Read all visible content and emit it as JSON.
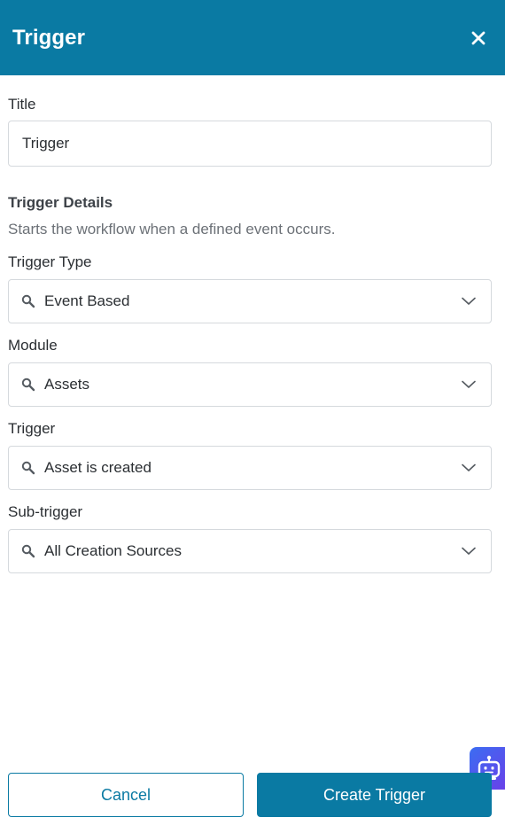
{
  "header": {
    "title": "Trigger",
    "close_icon": "close-icon"
  },
  "title_field": {
    "label": "Title",
    "value": "Trigger"
  },
  "details": {
    "heading": "Trigger Details",
    "description": "Starts the workflow when a defined event occurs."
  },
  "trigger_type": {
    "label": "Trigger Type",
    "value": "Event Based"
  },
  "module": {
    "label": "Module",
    "value": "Assets"
  },
  "trigger": {
    "label": "Trigger",
    "value": "Asset is created"
  },
  "sub_trigger": {
    "label": "Sub-trigger",
    "value": "All Creation Sources"
  },
  "footer": {
    "cancel_label": "Cancel",
    "create_label": "Create Trigger"
  },
  "colors": {
    "primary": "#0a7aa3",
    "border": "#d5d9dd",
    "bot_gradient_start": "#3b6df2",
    "bot_gradient_end": "#6b3fe8"
  },
  "icons": {
    "select_prefix": "search-icon",
    "select_suffix": "chevron-down-icon",
    "assistant": "robot-icon"
  }
}
